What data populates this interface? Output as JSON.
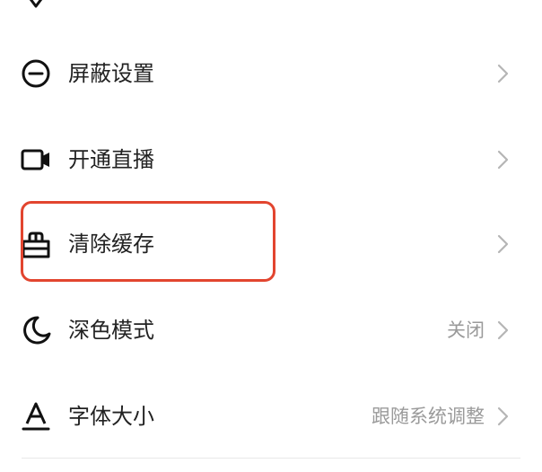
{
  "settings": {
    "items": [
      {
        "label": "屏蔽设置",
        "value": "",
        "icon": "block-icon"
      },
      {
        "label": "开通直播",
        "value": "",
        "icon": "video-camera-icon"
      },
      {
        "label": "清除缓存",
        "value": "",
        "icon": "broom-icon"
      },
      {
        "label": "深色模式",
        "value": "关闭",
        "icon": "moon-icon"
      },
      {
        "label": "字体大小",
        "value": "跟随系统调整",
        "icon": "font-size-icon"
      }
    ]
  },
  "colors": {
    "highlight": "#e2452f",
    "text": "#222222",
    "secondary": "#9a9a9a"
  }
}
